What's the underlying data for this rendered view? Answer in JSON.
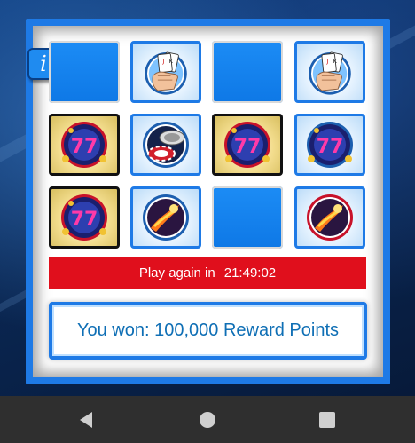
{
  "info_button": {
    "label": "i",
    "icon": "info-icon"
  },
  "board": {
    "tiles": [
      {
        "row": 1,
        "col": 1,
        "state": "hidden"
      },
      {
        "row": 1,
        "col": 2,
        "state": "revealed",
        "symbol": "hand-holding-cards-icon"
      },
      {
        "row": 1,
        "col": 3,
        "state": "hidden"
      },
      {
        "row": 1,
        "col": 4,
        "state": "revealed",
        "symbol": "hand-holding-cards-icon"
      },
      {
        "row": 2,
        "col": 1,
        "state": "revealed",
        "symbol": "slot-777-icon",
        "winning": true
      },
      {
        "row": 2,
        "col": 2,
        "state": "revealed",
        "symbol": "casino-chips-icon"
      },
      {
        "row": 2,
        "col": 3,
        "state": "revealed",
        "symbol": "slot-777-icon",
        "winning": true
      },
      {
        "row": 2,
        "col": 4,
        "state": "revealed",
        "symbol": "slot-777-icon"
      },
      {
        "row": 3,
        "col": 1,
        "state": "revealed",
        "symbol": "slot-777-icon",
        "winning": true
      },
      {
        "row": 3,
        "col": 2,
        "state": "revealed",
        "symbol": "comet-icon"
      },
      {
        "row": 3,
        "col": 3,
        "state": "hidden"
      },
      {
        "row": 3,
        "col": 4,
        "state": "revealed",
        "symbol": "comet-icon"
      }
    ]
  },
  "timer_banner": {
    "label": "Play again in",
    "countdown": "21:49:02"
  },
  "result": {
    "message": "You won: 100,000 Reward Points"
  },
  "navigation": {
    "back_icon": "back-icon",
    "home_icon": "home-icon",
    "recents_icon": "recents-icon"
  },
  "colors": {
    "frame": "#1e7ae6",
    "hidden_tile": "#1c8cf5",
    "banner_red": "#e00f1c",
    "result_text": "#0f6fb5",
    "nav_bar": "#2f2f2f"
  }
}
